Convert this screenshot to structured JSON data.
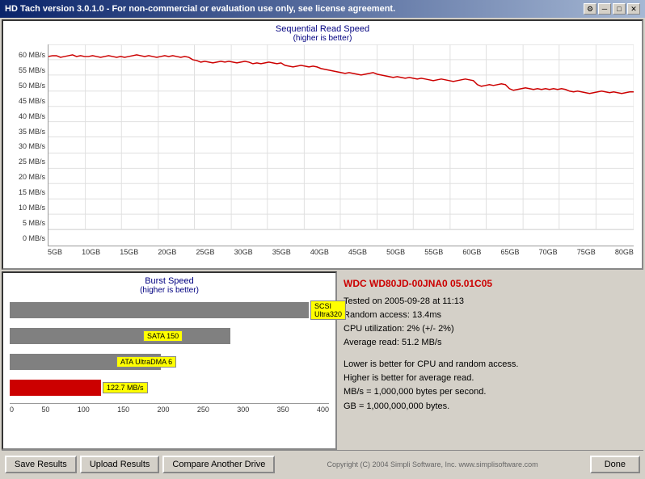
{
  "window": {
    "title": "HD Tach version 3.0.1.0  - For non-commercial or evaluation use only, see license agreement.",
    "settings_icon": "⚙",
    "min_btn": "─",
    "max_btn": "□",
    "close_btn": "✕"
  },
  "seq_chart": {
    "title": "Sequential Read Speed",
    "subtitle": "(higher is better)",
    "y_labels": [
      "0 MB/s",
      "5 MB/s",
      "10 MB/s",
      "15 MB/s",
      "20 MB/s",
      "25 MB/s",
      "30 MB/s",
      "35 MB/s",
      "40 MB/s",
      "45 MB/s",
      "50 MB/s",
      "55 MB/s",
      "60 MB/s"
    ],
    "x_labels": [
      "5GB",
      "10GB",
      "15GB",
      "20GB",
      "25GB",
      "30GB",
      "35GB",
      "40GB",
      "45GB",
      "50GB",
      "55GB",
      "60GB",
      "65GB",
      "70GB",
      "75GB",
      "80GB"
    ]
  },
  "burst_chart": {
    "title": "Burst Speed",
    "subtitle": "(higher is better)",
    "bars": [
      {
        "label": "SCSI Ultra320",
        "width_pct": 95,
        "color": "gray"
      },
      {
        "label": "SATA 150",
        "width_pct": 70,
        "color": "gray"
      },
      {
        "label": "ATA UltraDMA 6",
        "width_pct": 48,
        "color": "gray"
      },
      {
        "label": "122.7 MB/s",
        "width_pct": 29,
        "color": "red"
      }
    ],
    "x_labels": [
      "0",
      "50",
      "100",
      "150",
      "200",
      "250",
      "300",
      "350",
      "400"
    ]
  },
  "info": {
    "drive_name": "WDC WD80JD-00JNA0 05.01C05",
    "tested_on": "Tested on 2005-09-28 at 11:13",
    "random_access": "Random access: 13.4ms",
    "cpu_util": "CPU utilization: 2% (+/- 2%)",
    "avg_read": "Average read: 51.2 MB/s",
    "note1": "Lower is better for CPU and random access.",
    "note2": "Higher is better for average read.",
    "note3": "MB/s = 1,000,000 bytes per second.",
    "note4": "GB = 1,000,000,000 bytes."
  },
  "buttons": {
    "save": "Save Results",
    "upload": "Upload Results",
    "compare": "Compare Another Drive",
    "done": "Done"
  },
  "copyright": "Copyright (C) 2004 Simpli Software, Inc. www.simplisoftware.com"
}
